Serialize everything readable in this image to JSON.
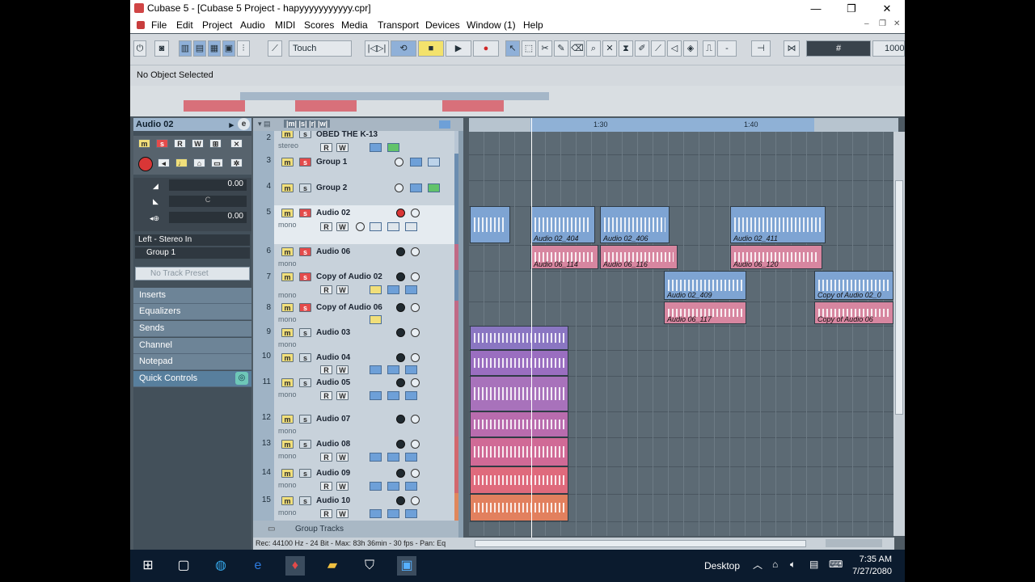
{
  "window": {
    "title": "Cubase 5 - [Cubase 5 Project - hapyyyyyyyyyyy.cpr]",
    "minimize": "—",
    "restore": "❐",
    "close": "✕"
  },
  "menu": [
    "File",
    "Edit",
    "Project",
    "Audio",
    "MIDI",
    "Scores",
    "Media",
    "Transport",
    "Devices",
    "Window (1)",
    "Help"
  ],
  "toolbar": {
    "automation_mode": "Touch",
    "grid": "1000",
    "quantize": "-"
  },
  "infoline": {
    "text": "No Object Selected"
  },
  "inspector": {
    "track_name": "Audio 02",
    "volume": "0.00",
    "pan": "C",
    "delay": "0.00",
    "routing_in": "Left - Stereo In",
    "routing_out": "Group 1",
    "preset_placeholder": "No Track Preset",
    "sections": [
      "Inserts",
      "Equalizers",
      "Sends",
      "Channel",
      "Notepad",
      "Quick Controls"
    ]
  },
  "tracks": [
    {
      "num": "2",
      "name": "OBED THE K-13",
      "sub": "stereo"
    },
    {
      "num": "3",
      "name": "Group 1",
      "sub": ""
    },
    {
      "num": "4",
      "name": "Group 2",
      "sub": ""
    },
    {
      "num": "5",
      "name": "Audio 02",
      "sub": "mono"
    },
    {
      "num": "6",
      "name": "Audio 06",
      "sub": "mono"
    },
    {
      "num": "7",
      "name": "Copy of Audio 02",
      "sub": "mono"
    },
    {
      "num": "8",
      "name": "Copy of Audio 06",
      "sub": "mono"
    },
    {
      "num": "9",
      "name": "Audio 03",
      "sub": "mono"
    },
    {
      "num": "10",
      "name": "Audio 04",
      "sub": "mono"
    },
    {
      "num": "11",
      "name": "Audio 05",
      "sub": "mono"
    },
    {
      "num": "12",
      "name": "Audio 07",
      "sub": "mono"
    },
    {
      "num": "13",
      "name": "Audio 08",
      "sub": "mono"
    },
    {
      "num": "14",
      "name": "Audio 09",
      "sub": "mono"
    },
    {
      "num": "15",
      "name": "Audio 10",
      "sub": "mono"
    }
  ],
  "group_tracks_label": "Group Tracks",
  "ruler": {
    "mark1": "1:30",
    "mark2": "1:40"
  },
  "events": [
    {
      "label": "Audio 02_404"
    },
    {
      "label": "Audio 02_406"
    },
    {
      "label": "Audio 02_411"
    },
    {
      "label": "Audio 06_114"
    },
    {
      "label": "Audio 06_116"
    },
    {
      "label": "Audio 06_120"
    },
    {
      "label": "Audio 02_409"
    },
    {
      "label": "Copy of Audio 02_0"
    },
    {
      "label": "Audio 06_117"
    },
    {
      "label": "Copy of Audio 06"
    }
  ],
  "status": "Rec: 44100 Hz - 24 Bit - Max: 83h 36min - 30 fps - Pan: Eq",
  "taskbar": {
    "desktop": "Desktop",
    "time": "7:35 AM",
    "date": "7/27/2080"
  }
}
